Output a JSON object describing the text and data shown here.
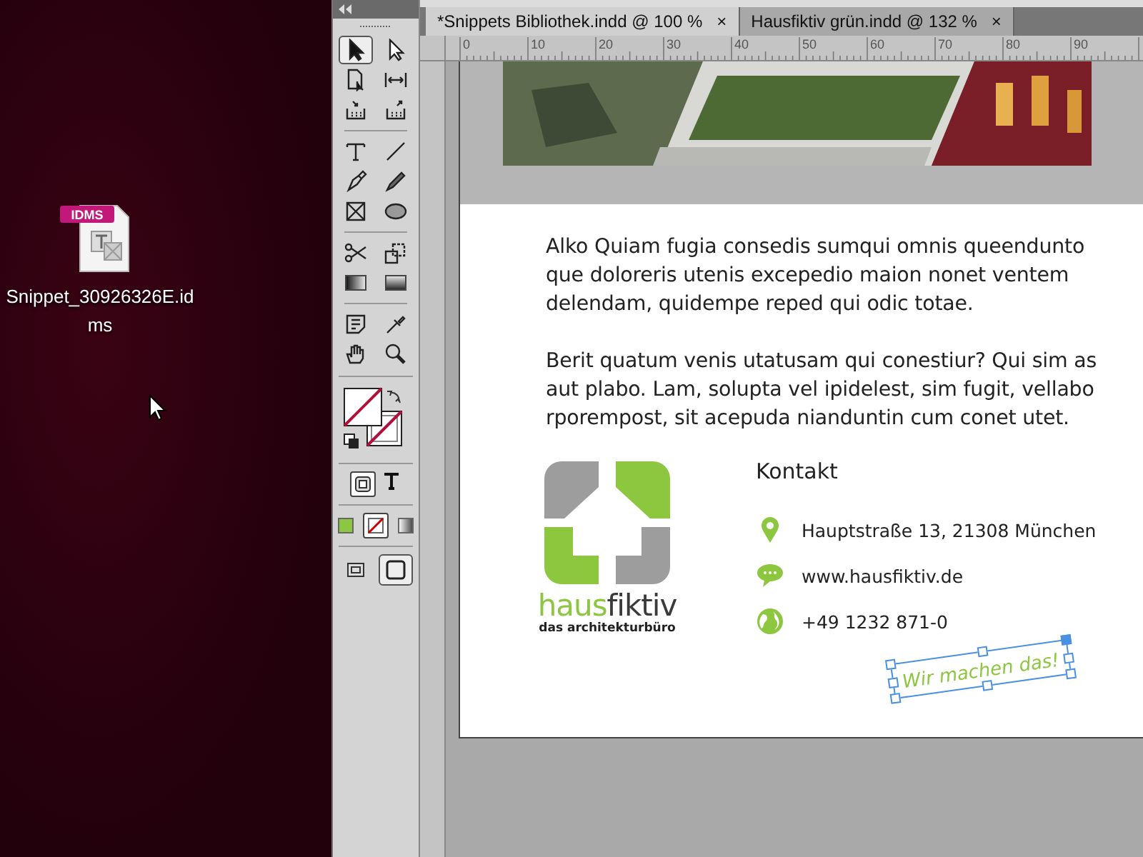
{
  "desktop": {
    "file_icon": {
      "badge": "IDMS",
      "label_lines": [
        "Snippet_30926326E.id",
        "ms"
      ]
    }
  },
  "toolbox": {
    "tools": [
      {
        "kind": "selection",
        "selected": true
      },
      {
        "kind": "direct-selection",
        "selected": false
      },
      {
        "kind": "page",
        "selected": false
      },
      {
        "kind": "gap",
        "selected": false
      },
      {
        "kind": "collector",
        "selected": false
      },
      {
        "kind": "placer",
        "selected": false
      },
      {
        "kind": "type",
        "selected": false
      },
      {
        "kind": "line",
        "selected": false
      },
      {
        "kind": "pen",
        "selected": false
      },
      {
        "kind": "pencil",
        "selected": false
      },
      {
        "kind": "rectangle-frame",
        "selected": false
      },
      {
        "kind": "ellipse",
        "selected": false
      },
      {
        "kind": "scissors",
        "selected": false
      },
      {
        "kind": "free-transform",
        "selected": false
      },
      {
        "kind": "gradient",
        "selected": false
      },
      {
        "kind": "gradient-feather",
        "selected": false
      },
      {
        "kind": "note",
        "selected": false
      },
      {
        "kind": "eyedropper",
        "selected": false
      },
      {
        "kind": "hand",
        "selected": false
      },
      {
        "kind": "zoom",
        "selected": false
      }
    ],
    "apply": [
      {
        "kind": "color",
        "selected": false
      },
      {
        "kind": "none",
        "selected": true
      },
      {
        "kind": "gradient",
        "selected": false
      }
    ],
    "screen_modes": [
      {
        "kind": "normal",
        "selected": false
      },
      {
        "kind": "preview",
        "selected": true
      }
    ]
  },
  "tabs": [
    {
      "label": "*Snippets Bibliothek.indd @ 100 %",
      "close": "×",
      "selected": true
    },
    {
      "label": "Hausfiktiv grün.indd @ 132 %",
      "close": "×",
      "selected": false
    }
  ],
  "ruler": {
    "marks": [
      "0",
      "10",
      "20",
      "30",
      "40",
      "50",
      "60",
      "70",
      "80",
      "90"
    ]
  },
  "page": {
    "paragraphs": [
      "Alko Quiam fugia consedis sumqui omnis queendunto que doloreris utenis excepedio maion nonet ventem delendam, quidempe reped qui odic totae.",
      "Berit quatum venis utatusam qui conestiur? Qui sim as aut plabo. Lam, solupta vel ipidelest, sim fugit, vellabo rporempost, sit acepuda nianduntin cum conet utet."
    ],
    "logo": {
      "parts": [
        {
          "text": "haus",
          "color": "#8dc63f"
        },
        {
          "text": "fiktiv",
          "color": "#3a3a3a"
        }
      ],
      "tagline": "das architekturbüro"
    },
    "contact": {
      "heading": "Kontakt",
      "items": [
        {
          "kind": "location",
          "text": "Hauptstraße 13, 21308 München"
        },
        {
          "kind": "chat",
          "text": "www.hausfiktiv.de"
        },
        {
          "kind": "globe",
          "text": "+49 1232 871-0"
        }
      ]
    },
    "slogan": {
      "text": "Wir machen das!",
      "selected": true
    }
  }
}
